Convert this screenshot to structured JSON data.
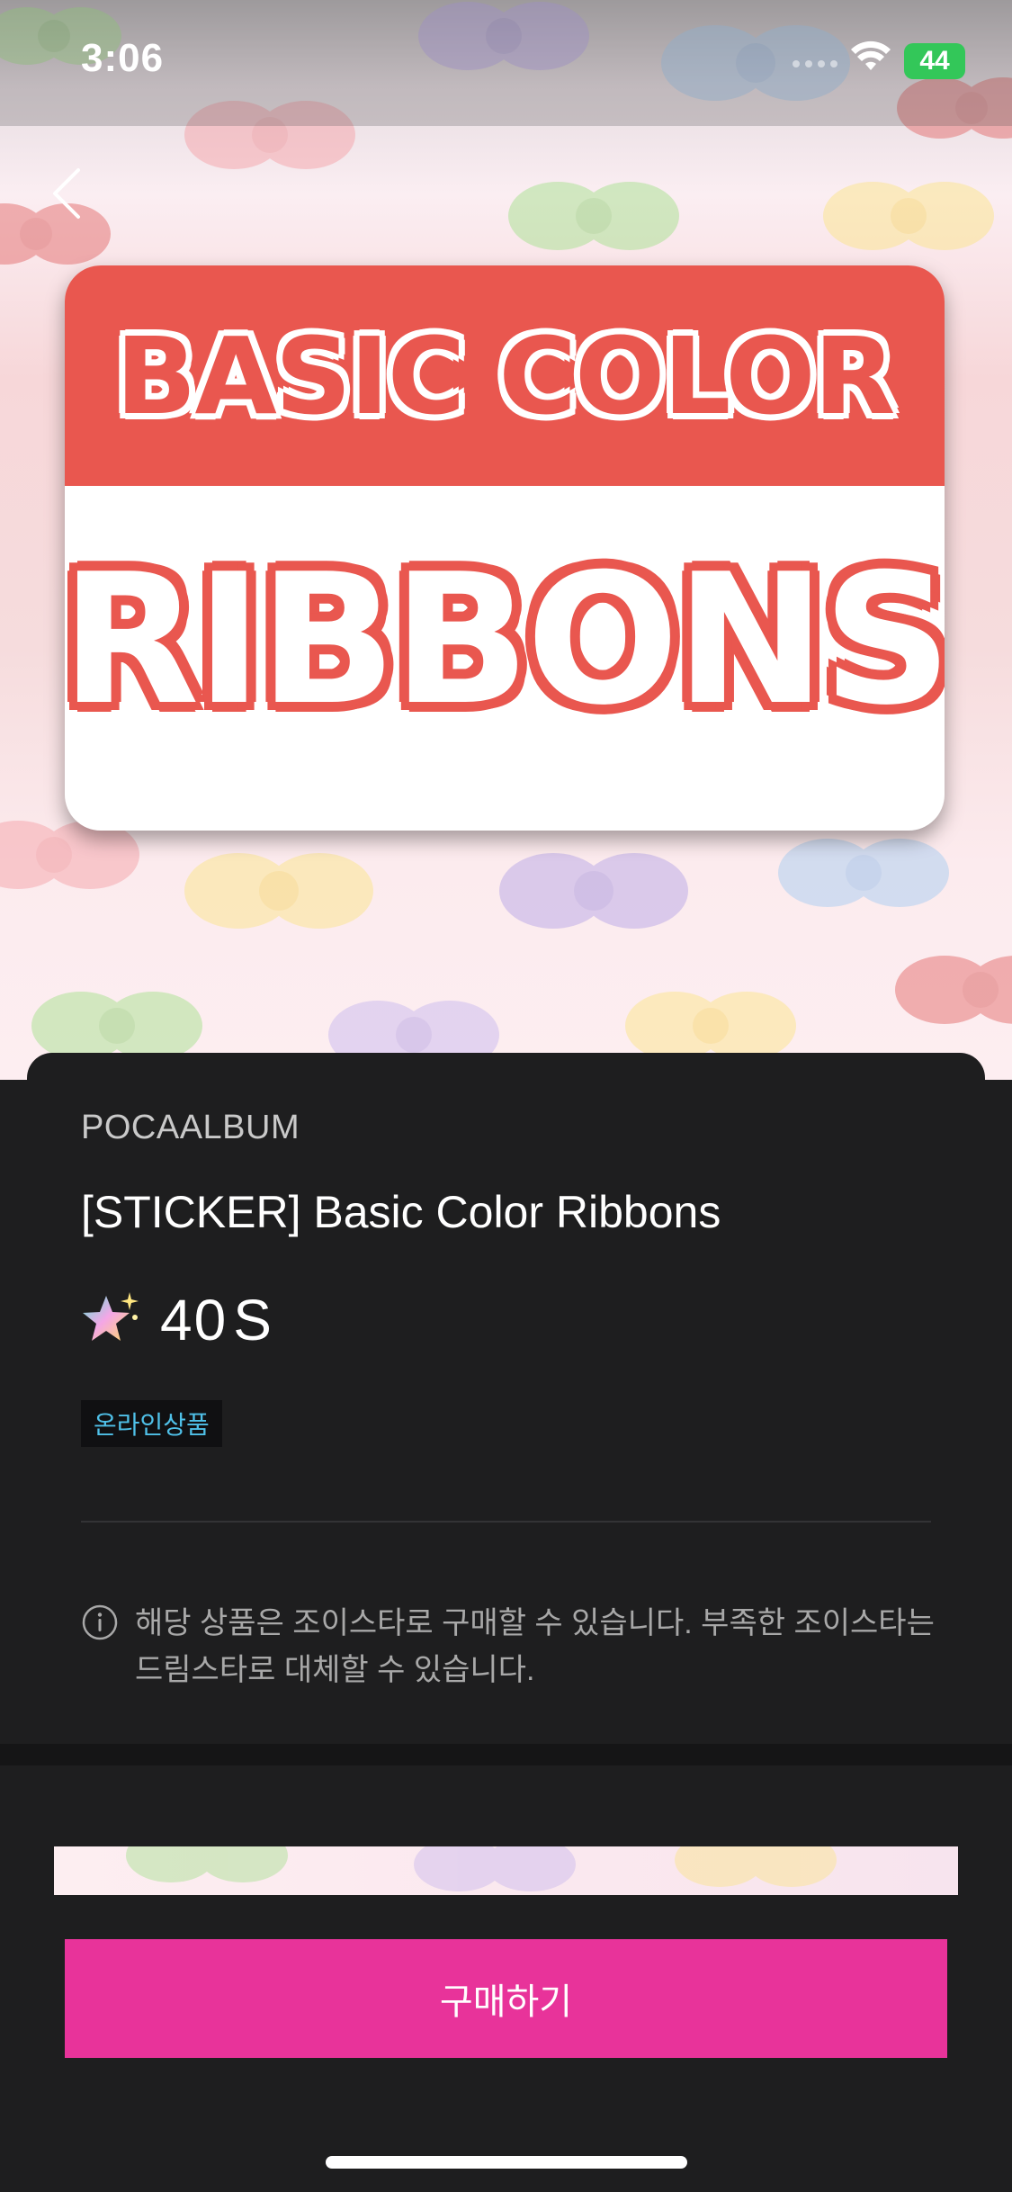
{
  "status_bar": {
    "time": "3:06",
    "battery": "44"
  },
  "product_image": {
    "top_text": "BASIC COLOR",
    "bottom_text": "RIBBONS",
    "accent_color": "#e9574f"
  },
  "product": {
    "brand": "POCAALBUM",
    "title": "[STICKER] Basic Color Ribbons",
    "price": "40",
    "price_unit": "S",
    "badge": "온라인상품",
    "notice": "해당 상품은 조이스타로 구매할 수 있습니다. 부족한 조이스타는 드림스타로 대체할 수 있습니다."
  },
  "actions": {
    "buy_label": "구매하기",
    "buy_color": "#e8339a"
  },
  "icons": {
    "back": "chevron-left-icon",
    "info": "info-icon",
    "star": "star-icon",
    "wifi": "wifi-icon"
  }
}
